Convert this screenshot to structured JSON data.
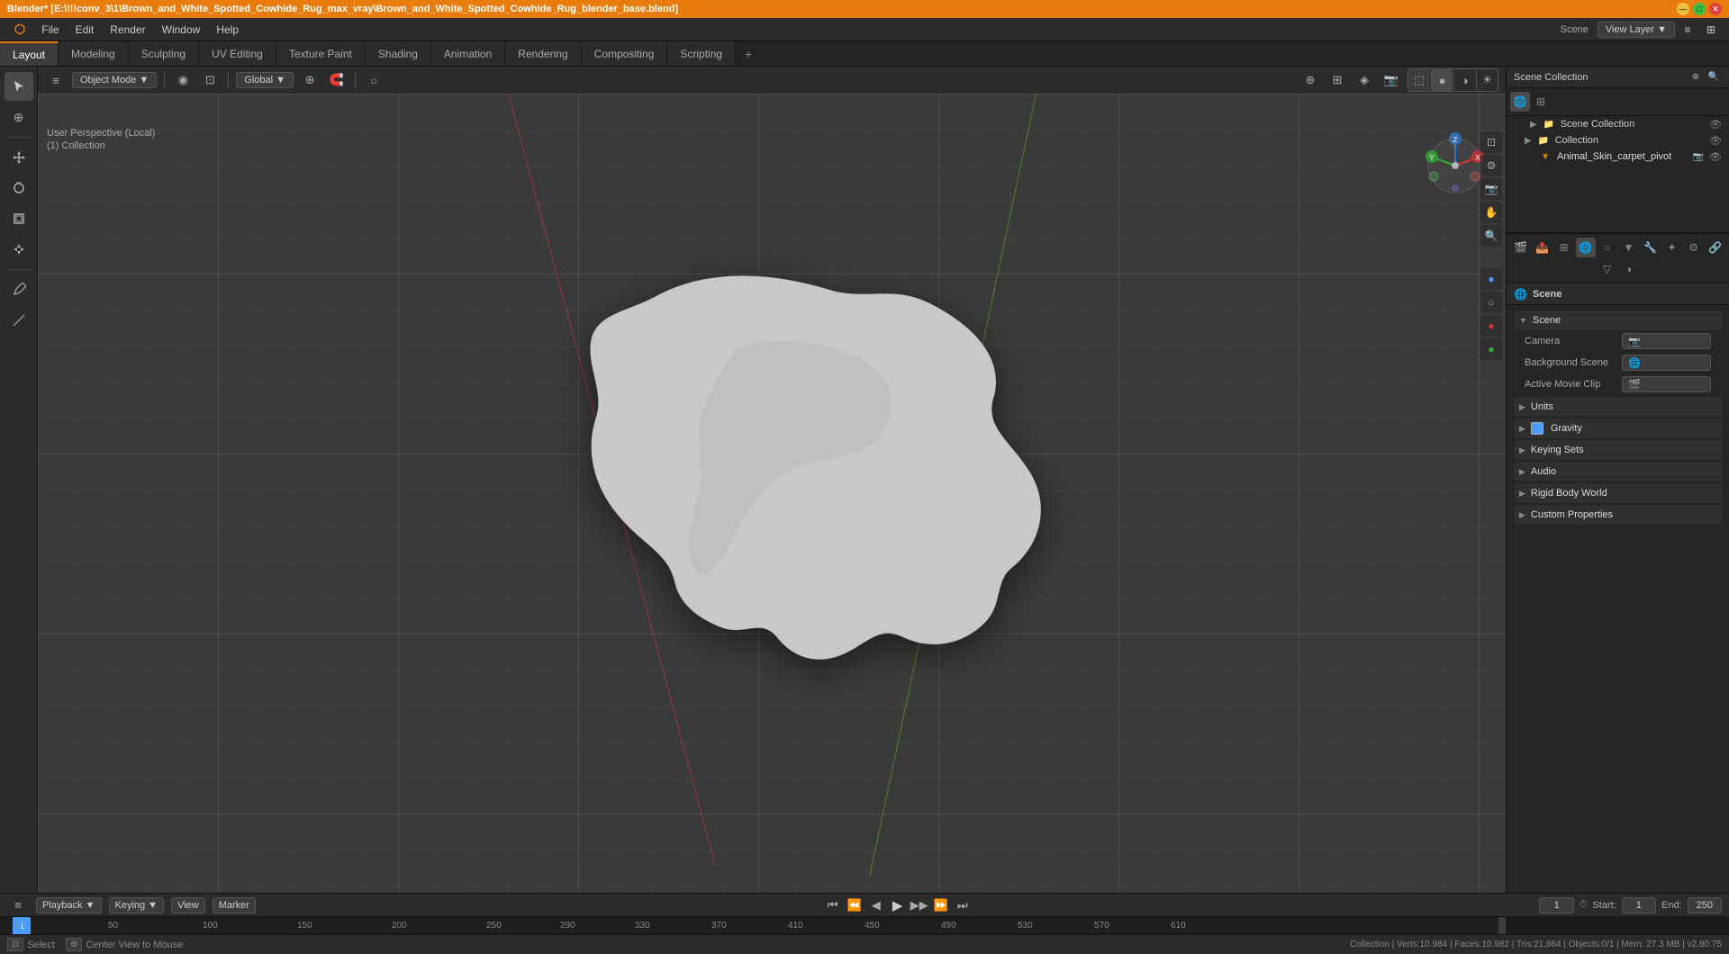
{
  "titleBar": {
    "title": "Blender* [E:\\!!!conv_3\\1\\Brown_and_White_Spotted_Cowhide_Rug_max_vray\\Brown_and_White_Spotted_Cowhide_Rug_blender_base.blend]",
    "windowControls": {
      "minimize": "—",
      "maximize": "□",
      "close": "✕"
    }
  },
  "menuBar": {
    "items": [
      "Blender",
      "File",
      "Edit",
      "Render",
      "Window",
      "Help"
    ]
  },
  "workspaceTabs": {
    "items": [
      {
        "label": "Layout",
        "active": true
      },
      {
        "label": "Modeling"
      },
      {
        "label": "Sculpting"
      },
      {
        "label": "UV Editing"
      },
      {
        "label": "Texture Paint"
      },
      {
        "label": "Shading"
      },
      {
        "label": "Animation"
      },
      {
        "label": "Rendering"
      },
      {
        "label": "Compositing"
      },
      {
        "label": "Scripting"
      }
    ],
    "addLabel": "+"
  },
  "viewport": {
    "modeLabel": "Object Mode",
    "modeArrow": "▼",
    "transformLabel": "Global",
    "transformArrow": "▼",
    "viewInfo": "User Perspective (Local)",
    "collectionInfo": "(1) Collection",
    "gizmoLabel": "View Layer",
    "headerIcons": [
      "⚙",
      "🔍",
      "◉",
      "⊞",
      "⊡",
      "⊕"
    ]
  },
  "outliner": {
    "title": "Scene Collection",
    "items": [
      {
        "label": "Collection",
        "level": 0,
        "icon": "📁",
        "hasEye": true
      },
      {
        "label": "Animal_Skin_carpet_pivot",
        "level": 1,
        "icon": "🔺",
        "hasEye": true
      }
    ]
  },
  "propertiesPanel": {
    "title": "Scene",
    "panelTitle": "Scene",
    "sections": [
      {
        "label": "Scene",
        "open": true,
        "subsections": [
          {
            "label": "Camera",
            "value": ""
          },
          {
            "label": "Background Scene",
            "value": ""
          },
          {
            "label": "Active Movie Clip",
            "value": ""
          }
        ]
      },
      {
        "label": "Units",
        "open": false
      },
      {
        "label": "Gravity",
        "open": false,
        "hasCheckbox": true
      },
      {
        "label": "Keying Sets",
        "open": false
      },
      {
        "label": "Audio",
        "open": false
      },
      {
        "label": "Rigid Body World",
        "open": false
      },
      {
        "label": "Custom Properties",
        "open": false
      }
    ],
    "icons": [
      "📷",
      "🌍",
      "🎬",
      "👤",
      "🔧",
      "📊",
      "🎨",
      "🎯",
      "⚙"
    ]
  },
  "timeline": {
    "playbackLabel": "Playback",
    "playbackArrow": "▼",
    "keyingLabel": "Keying",
    "keyingArrow": "▼",
    "viewLabel": "View",
    "markerLabel": "Marker",
    "currentFrame": "1",
    "startLabel": "Start:",
    "startFrame": "1",
    "endLabel": "End:",
    "endFrame": "250",
    "controls": {
      "jumpStart": "⏮",
      "stepBack": "⏪",
      "frameBack": "◀",
      "play": "▶",
      "frameForward": "▶▶",
      "stepForward": "⏩",
      "jumpEnd": "⏭"
    },
    "tickLabels": [
      "1",
      "50",
      "100",
      "150",
      "200",
      "250"
    ],
    "tickPositions": [
      0,
      106,
      213,
      320,
      426,
      533
    ]
  },
  "statusBar": {
    "selectLabel": "Select",
    "centerViewLabel": "Center View to Mouse",
    "info": "Collection | Verts:10.984 | Faces:10.982 | Tris:21.964 | Objects:0/1 | Mem: 27.3 MB | v2.80.75"
  }
}
